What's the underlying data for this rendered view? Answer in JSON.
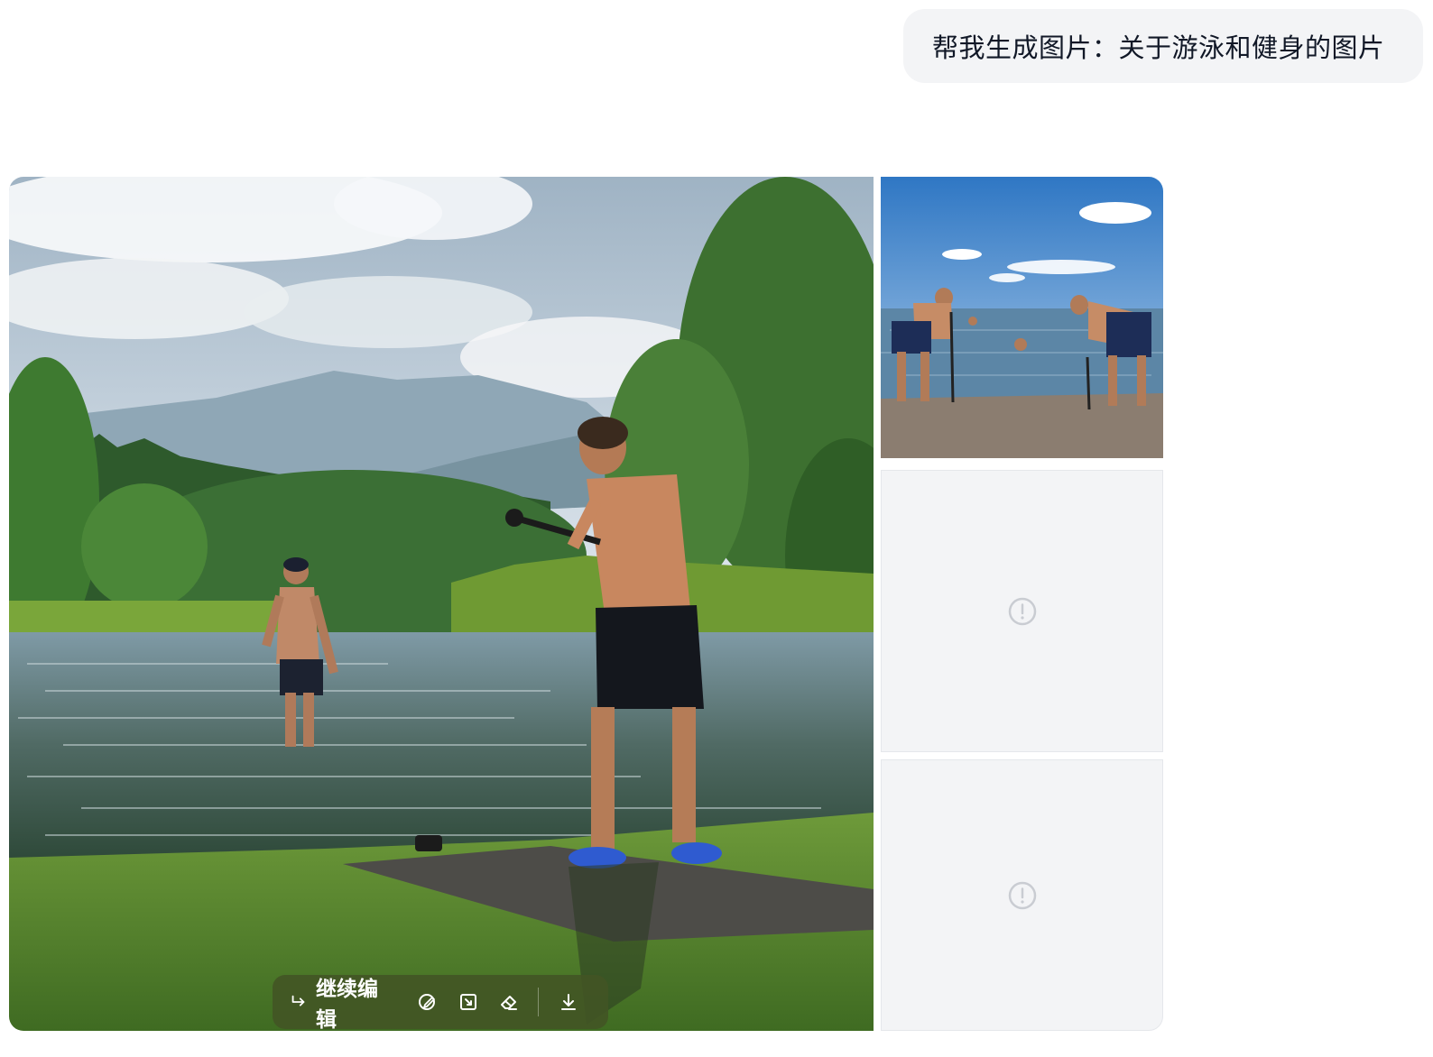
{
  "chat": {
    "user_prompt": "帮我生成图片：关于游泳和健身的图片"
  },
  "toolbar": {
    "continue_edit_label": "继续编辑"
  },
  "images": {
    "main": "lake swimming and fitness scene",
    "thumb1": "beach workout scene",
    "thumb2": "loading-error placeholder",
    "thumb3": "loading-error placeholder"
  },
  "icons": {
    "continue_edit": "reply-arrow-icon",
    "remix": "pencil-circle-icon",
    "expand": "expand-icon",
    "erase": "eraser-icon",
    "download": "download-icon",
    "error": "alert-circle-icon"
  },
  "colors": {
    "bubble_bg": "#f3f4f6",
    "toolbar_bg": "#425424",
    "placeholder_bg": "#f3f4f6"
  }
}
